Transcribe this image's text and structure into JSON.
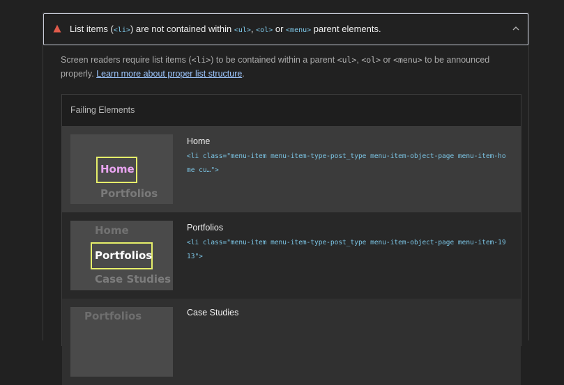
{
  "issue": {
    "title_parts": {
      "pre": "List items (",
      "tag_li": "<li>",
      "mid1": ") are not contained within ",
      "tag_ul": "<ul>",
      "comma": ", ",
      "tag_ol": "<ol>",
      "or": " or ",
      "tag_menu": "<menu>",
      "post": " parent elements."
    },
    "description": {
      "pre": "Screen readers require list items (",
      "tag_li": "<li>",
      "mid1": ") to be contained within a parent ",
      "tag_ul": "<ul>",
      "comma": ", ",
      "tag_ol": "<ol>",
      "or": " or ",
      "tag_menu": "<menu>",
      "mid2": " to be announced properly. ",
      "link": "Learn more about proper list structure",
      "end": "."
    },
    "severity_color": "#e05b4b"
  },
  "failing": {
    "title": "Failing Elements",
    "items": [
      {
        "name": "Home",
        "code": "<li class=\"menu-item menu-item-type-post_type menu-item-object-page menu-item-home cu…\">",
        "thumb": {
          "primary": "Home",
          "below": "Portfolios"
        }
      },
      {
        "name": "Portfolios",
        "code": "<li class=\"menu-item menu-item-type-post_type menu-item-object-page menu-item-1913\">",
        "thumb": {
          "above": "Home",
          "primary": "Portfolios",
          "below": "Case Studies"
        }
      },
      {
        "name": "Case Studies",
        "thumb": {
          "above": "Portfolios"
        }
      }
    ]
  }
}
